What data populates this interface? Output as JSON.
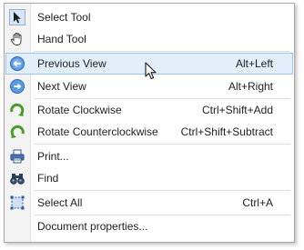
{
  "menu": {
    "items": [
      {
        "label": "Select Tool",
        "shortcut": "",
        "icon": "arrow-pointer-icon"
      },
      {
        "label": "Hand Tool",
        "shortcut": "",
        "icon": "hand-icon"
      },
      {
        "label": "Previous View",
        "shortcut": "Alt+Left",
        "icon": "previous-view-icon",
        "highlighted": true
      },
      {
        "label": "Next View",
        "shortcut": "Alt+Right",
        "icon": "next-view-icon"
      },
      {
        "label": "Rotate Clockwise",
        "shortcut": "Ctrl+Shift+Add",
        "icon": "rotate-clockwise-icon"
      },
      {
        "label": "Rotate Counterclockwise",
        "shortcut": "Ctrl+Shift+Subtract",
        "icon": "rotate-counterclockwise-icon"
      },
      {
        "label": "Print...",
        "shortcut": "",
        "icon": "printer-icon"
      },
      {
        "label": "Find",
        "shortcut": "",
        "icon": "binoculars-icon"
      },
      {
        "label": "Select All",
        "shortcut": "Ctrl+A",
        "icon": "select-all-icon"
      },
      {
        "label": "Document properties...",
        "shortcut": "",
        "icon": ""
      }
    ]
  },
  "colors": {
    "highlight_bg": "#e2eefa",
    "highlight_border": "#9cc3ea",
    "icon_blue": "#3b7fd0",
    "icon_green": "#4a9a2a",
    "gutter": "#f3f3f3"
  }
}
